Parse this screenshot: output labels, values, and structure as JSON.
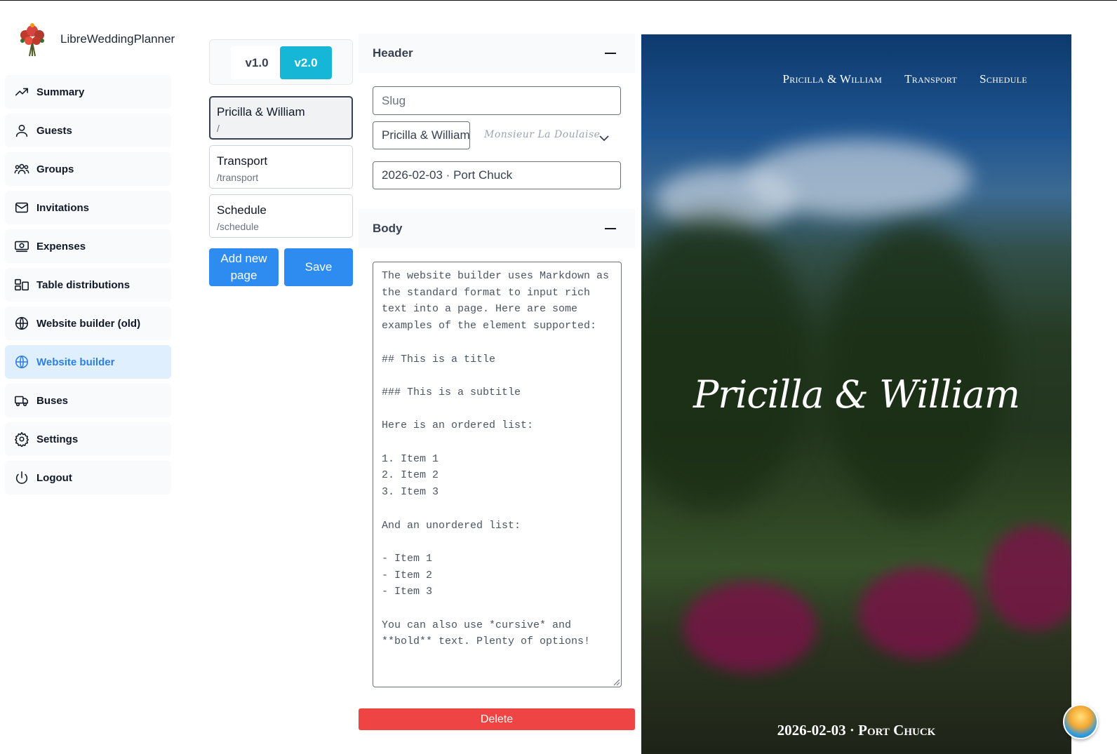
{
  "app": {
    "name": "LibreWeddingPlanner"
  },
  "sidebar": {
    "items": [
      {
        "label": "Summary",
        "icon": "trending-up-icon"
      },
      {
        "label": "Guests",
        "icon": "user-icon"
      },
      {
        "label": "Groups",
        "icon": "users-icon"
      },
      {
        "label": "Invitations",
        "icon": "envelope-icon"
      },
      {
        "label": "Expenses",
        "icon": "banknote-icon"
      },
      {
        "label": "Table distributions",
        "icon": "table-layout-icon"
      },
      {
        "label": "Website builder (old)",
        "icon": "globe-icon"
      },
      {
        "label": "Website builder",
        "icon": "globe-icon",
        "active": true
      },
      {
        "label": "Buses",
        "icon": "truck-icon"
      },
      {
        "label": "Settings",
        "icon": "gear-icon"
      },
      {
        "label": "Logout",
        "icon": "power-icon"
      }
    ]
  },
  "versions": {
    "v1": "v1.0",
    "v2": "v2.0",
    "selected": "v2.0",
    "selected_color": "#16b6d6"
  },
  "pages": [
    {
      "title": "Pricilla & William",
      "slug": "/"
    },
    {
      "title": "Transport",
      "slug": "/transport"
    },
    {
      "title": "Schedule",
      "slug": "/schedule"
    }
  ],
  "actions": {
    "add_page": "Add new page",
    "save": "Save",
    "delete": "Delete"
  },
  "header_section": {
    "title": "Header",
    "slug_placeholder": "Slug",
    "names_value": "Pricilla & William",
    "font_preview": "Monsieur La Doulaise",
    "subtitle_value": "2026-02-03 · Port Chuck"
  },
  "body_section": {
    "title": "Body",
    "markdown": "The website builder uses Markdown as the standard format to input rich text into a page. Here are some examples of the element supported:\n\n## This is a title\n\n### This is a subtitle\n\nHere is an ordered list:\n\n1. Item 1\n2. Item 2\n3. Item 3\n\nAnd an unordered list:\n\n- Item 1\n- Item 2\n- Item 3\n\nYou can also use *cursive* and **bold** text. Plenty of options!"
  },
  "preview": {
    "nav": [
      "Pricilla & William",
      "Transport",
      "Schedule"
    ],
    "names": "Pricilla & William",
    "date_place": "2026-02-03 · Port Chuck"
  },
  "colors": {
    "primary": "#2e8bf0",
    "danger": "#ef4444",
    "active_nav_bg": "#e0effe",
    "active_nav_text": "#2b7fe0"
  }
}
